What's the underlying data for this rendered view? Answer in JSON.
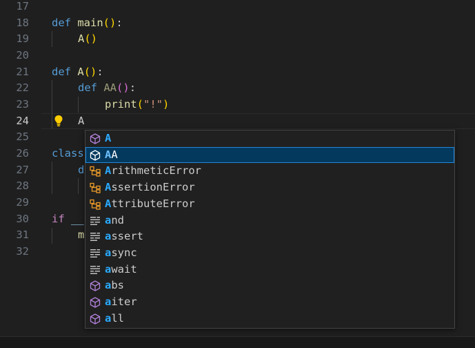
{
  "colors": {
    "background": "#1f1f1f",
    "keyword": "#569cd6",
    "function": "#dcdcaa",
    "bracket": "#ffd700",
    "string": "#ce9178",
    "control": "#c586c0",
    "selection": "#04395e",
    "match_highlight": "#2aaaff",
    "module_icon": "#b180d7",
    "class_icon": "#ee9d28"
  },
  "editor": {
    "current_line": "24",
    "lines": [
      {
        "num": "17"
      },
      {
        "num": "18",
        "kw": "def",
        "name": "main",
        "rest": "():"
      },
      {
        "num": "19",
        "call": "A",
        "paren": "()"
      },
      {
        "num": "20"
      },
      {
        "num": "21",
        "kw": "def",
        "name": "A",
        "rest": "():"
      },
      {
        "num": "22",
        "kw": "def",
        "name": "AA",
        "rest": "():"
      },
      {
        "num": "23",
        "call": "print",
        "open": "(",
        "str": "\"!\"",
        "close": ")"
      },
      {
        "num": "24",
        "text": "A"
      },
      {
        "num": "25"
      },
      {
        "num": "26",
        "kw": "class",
        "rest": "d"
      },
      {
        "num": "27",
        "text": "d"
      },
      {
        "num": "28"
      },
      {
        "num": "29"
      },
      {
        "num": "30",
        "kw": "if",
        "text": "__"
      },
      {
        "num": "31",
        "text": "m"
      },
      {
        "num": "32"
      }
    ]
  },
  "suggestions": {
    "selected_index": 1,
    "items": [
      {
        "match": "A",
        "rest": "",
        "kind": "module-icon"
      },
      {
        "match": "A",
        "rest": "A",
        "kind": "module-icon"
      },
      {
        "match": "A",
        "rest": "rithmeticError",
        "kind": "class-icon"
      },
      {
        "match": "A",
        "rest": "ssertionError",
        "kind": "class-icon"
      },
      {
        "match": "A",
        "rest": "ttributeError",
        "kind": "class-icon"
      },
      {
        "match": "a",
        "rest": "nd",
        "kind": "keyword-icon"
      },
      {
        "match": "a",
        "rest": "ssert",
        "kind": "keyword-icon"
      },
      {
        "match": "a",
        "rest": "sync",
        "kind": "keyword-icon"
      },
      {
        "match": "a",
        "rest": "wait",
        "kind": "keyword-icon"
      },
      {
        "match": "a",
        "rest": "bs",
        "kind": "module-icon"
      },
      {
        "match": "a",
        "rest": "iter",
        "kind": "module-icon"
      },
      {
        "match": "a",
        "rest": "ll",
        "kind": "module-icon"
      }
    ]
  }
}
